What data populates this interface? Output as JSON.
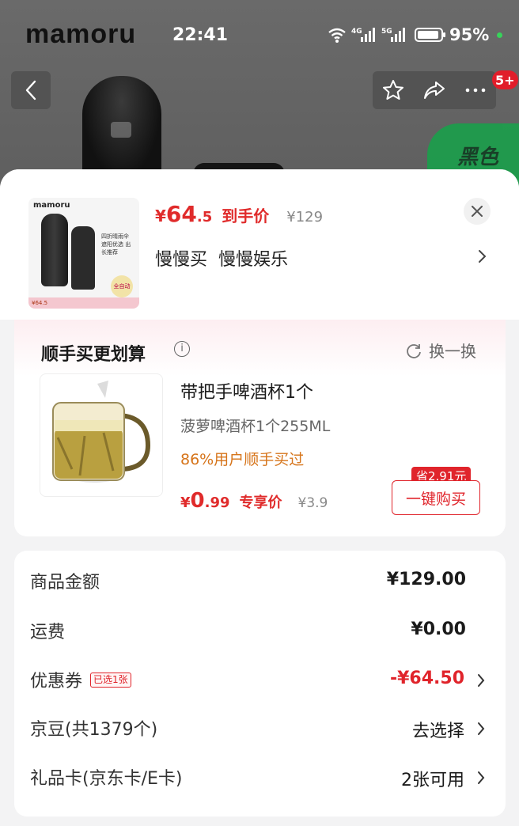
{
  "status_bar": {
    "brand": "mamoru",
    "time": "22:41",
    "net_4g": "4G",
    "net_5g": "5G",
    "battery": "95%"
  },
  "top_nav": {
    "badge": "5+"
  },
  "backdrop": {
    "green_label": "黑色"
  },
  "product": {
    "thumb_brand": "mamoru",
    "thumb_text": "四折晴雨伞 遮阳优选 出长推荐",
    "thumb_auto": "全自动",
    "thumb_strip": "¥64.5",
    "price_yen": "¥",
    "price_int": "64",
    "price_dec": ".5",
    "price_tag": "到手价",
    "price_original": "¥129",
    "spec_1": "慢慢买",
    "spec_2": "慢慢娱乐"
  },
  "addon": {
    "title": "顺手买更划算",
    "swap_label": "换一换",
    "name": "带把手啤酒杯1个",
    "subtitle": "菠萝啤酒杯1个255ML",
    "popularity": "86%用户顺手买过",
    "price_yen": "¥",
    "price_int": "0",
    "price_dec": ".99",
    "price_tag": "专享价",
    "price_original": "¥3.9",
    "save_badge": "省2.91元",
    "buy_button": "一键购买"
  },
  "summary": {
    "rows": [
      {
        "label": "商品金额",
        "value": "¥129.00"
      },
      {
        "label": "运费",
        "value": "¥0.00"
      },
      {
        "label": "优惠券",
        "badge": "已选1张",
        "value": "-¥64.50"
      },
      {
        "label": "京豆(共1379个)",
        "value": "去选择"
      },
      {
        "label": "礼品卡(京东卡/E卡)",
        "value": "2张可用"
      }
    ]
  },
  "colors": {
    "accent_red": "#e0242b",
    "accent_orange": "#d6741a",
    "sheet_bg": "#f3f3f4"
  }
}
